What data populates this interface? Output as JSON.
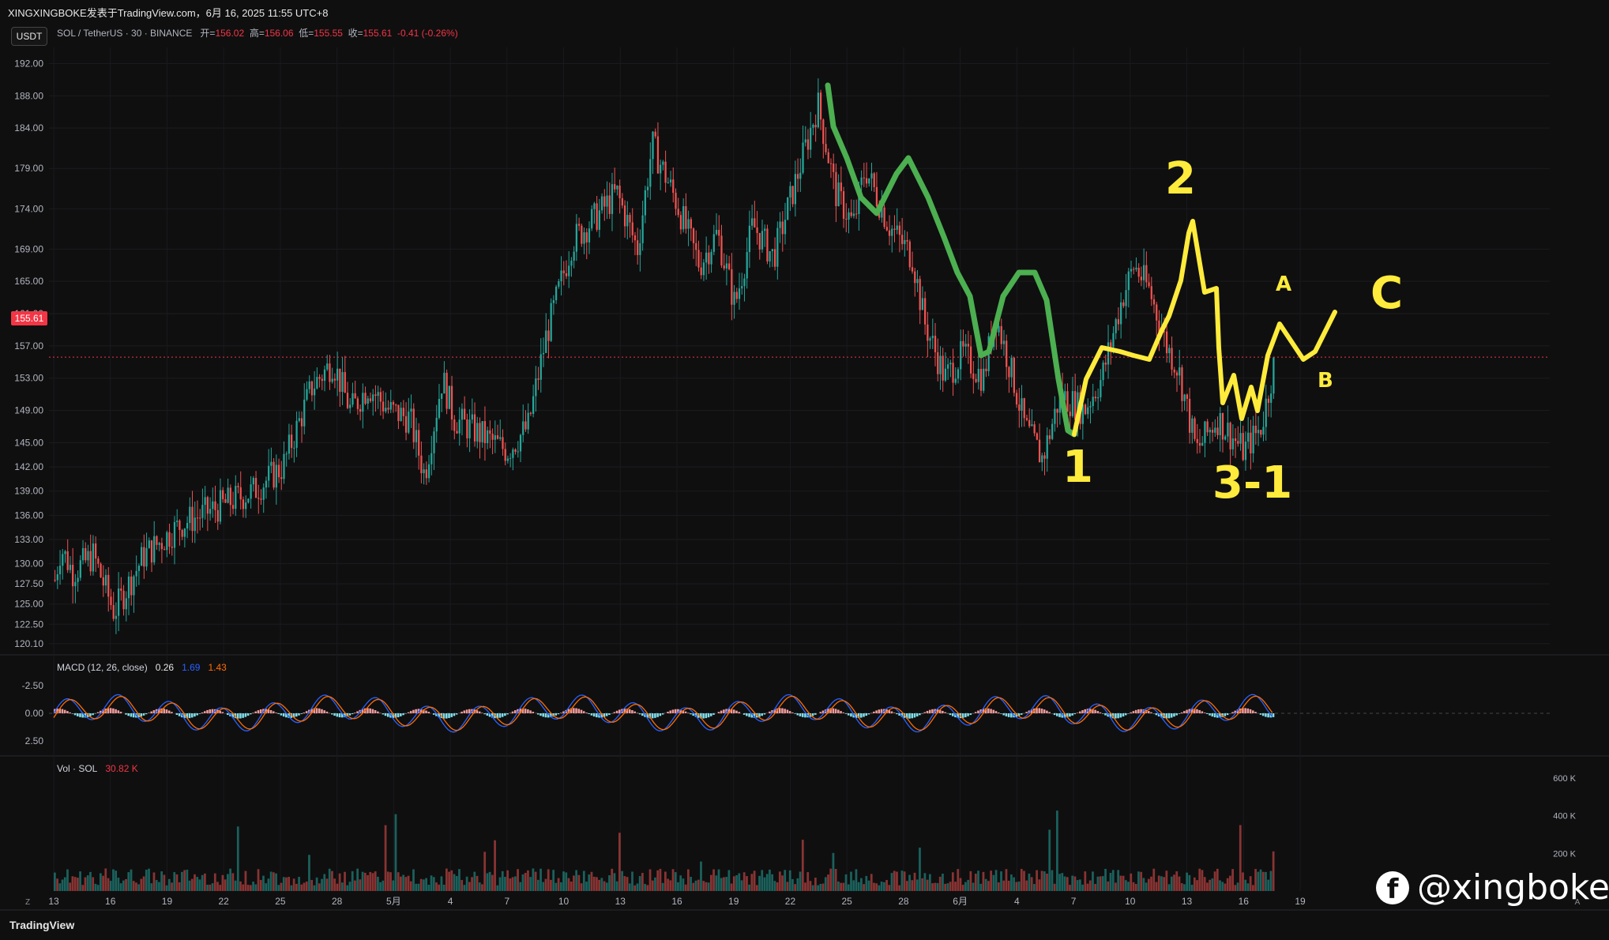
{
  "header": {
    "attribution": "XINGXINGBOKE发表于TradingView.com，6月 16, 2025 11:55 UTC+8",
    "quote_badge": "USDT",
    "symbol": "SOL / TetherUS · 30 · BINANCE",
    "open_label": "开=",
    "open": "156.02",
    "high_label": "高=",
    "high": "156.06",
    "low_label": "低=",
    "low": "155.55",
    "close_label": "收=",
    "close": "155.61",
    "change": "-0.41 (-0.26%)"
  },
  "last_price_tag": "155.61",
  "macd": {
    "label": "MACD (12, 26, close)",
    "v1": "0.26",
    "v2": "1.69",
    "v3": "1.43"
  },
  "volume": {
    "label": "Vol · SOL",
    "value": "30.82 K"
  },
  "footer": {
    "brand": "TradingView",
    "scale_z": "Z",
    "scale_a": "A"
  },
  "watermark": {
    "icon": "facebook-icon",
    "handle": "@xingboke"
  },
  "colors": {
    "up": "#26a69a",
    "down": "#ef5350",
    "green_annot": "#4caf50",
    "yellow_annot": "#ffeb3b",
    "macd_line": "#2962ff",
    "signal_line": "#ff6d00",
    "price_line": "#f23645"
  },
  "annotations": {
    "labels": [
      "1",
      "2",
      "3-1",
      "A",
      "B",
      "C"
    ]
  },
  "chart_data": [
    {
      "type": "candlestick",
      "title": "SOL / TetherUS · 30 · BINANCE",
      "y_ticks": [
        "192.00",
        "188.00",
        "184.00",
        "179.00",
        "174.00",
        "169.00",
        "165.00",
        "161.00",
        "157.00",
        "153.00",
        "149.00",
        "145.00",
        "142.00",
        "139.00",
        "136.00",
        "133.00",
        "130.00",
        "127.50",
        "125.00",
        "122.50",
        "120.10"
      ],
      "x_ticks": [
        "13",
        "16",
        "19",
        "22",
        "25",
        "28",
        "5月",
        "4",
        "7",
        "10",
        "13",
        "16",
        "19",
        "22",
        "25",
        "28",
        "6月",
        "4",
        "7",
        "10",
        "13",
        "16",
        "19"
      ],
      "ylim": [
        119,
        194
      ],
      "price_path": {
        "x": [
          0,
          0.2,
          0.6,
          1.3,
          2.0,
          3.0,
          4.3,
          5.5,
          6.7,
          7.7,
          8.7,
          9.4,
          10.0,
          10.6,
          11.3,
          12.0,
          12.5,
          13.1,
          13.5,
          14.4,
          15.3,
          16.0,
          16.6,
          17.5,
          18.3,
          19.0,
          19.7,
          20.2,
          21.0,
          21.8,
          22.4,
          23.0,
          23.6,
          24.3,
          25.1,
          25.8,
          26.4,
          27.0,
          27.4,
          28.2,
          29.0,
          29.4,
          30.1,
          30.7,
          31.4,
          31.8,
          32.4,
          32.8,
          33.4,
          34.0,
          34.8,
          35.4,
          36.1,
          36.5,
          37.0,
          37.6,
          38.0,
          38.6,
          39.3,
          40.2,
          40.8,
          41.3,
          42.0,
          43.2
        ],
        "y": [
          128,
          132,
          129,
          131,
          124,
          131,
          135,
          137,
          139,
          142,
          152,
          155,
          149,
          152,
          149,
          148,
          141,
          153,
          148,
          146,
          144,
          147,
          158,
          170,
          173,
          176,
          169,
          182,
          175,
          167,
          171,
          162,
          172,
          168,
          178,
          187,
          176,
          172,
          179,
          172,
          168,
          160,
          153,
          156,
          153,
          161,
          153,
          147,
          143,
          151,
          149,
          153,
          163,
          167,
          164,
          157,
          154,
          144,
          148,
          144,
          147,
          156,
          155.6,
          155.6
        ]
      },
      "last_price": 155.61
    },
    {
      "type": "line",
      "title": "MACD (12, 26, close)",
      "y_ticks": [
        "-2.50",
        "0.00",
        "2.50"
      ],
      "series": [
        {
          "name": "MACD"
        },
        {
          "name": "Signal"
        }
      ]
    },
    {
      "type": "bar",
      "title": "Vol · SOL",
      "y_ticks": [
        "600 K",
        "400 K",
        "200 K"
      ]
    }
  ]
}
